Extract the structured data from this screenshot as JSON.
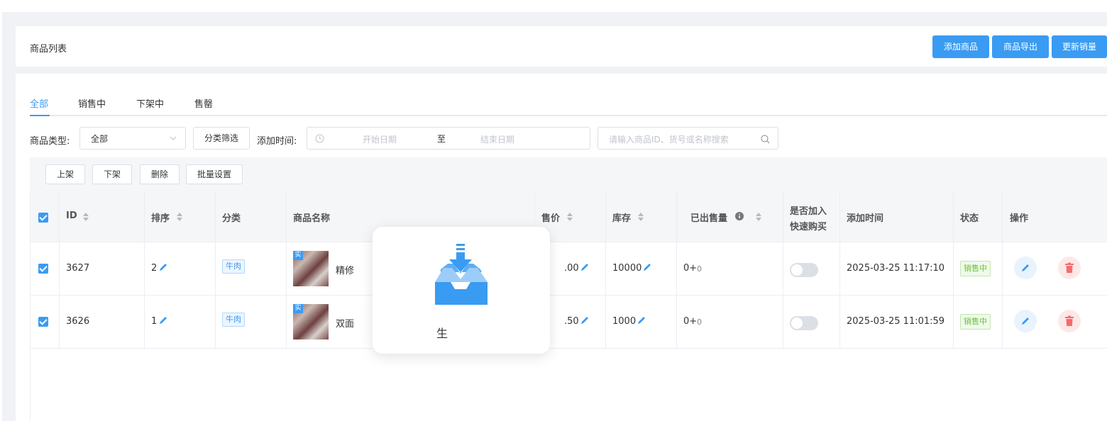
{
  "header": {
    "title": "商品列表",
    "buttons": [
      "添加商品",
      "商品导出",
      "更新销量"
    ]
  },
  "tabs": [
    "全部",
    "销售中",
    "下架中",
    "售罄"
  ],
  "filters": {
    "type_label": "商品类型:",
    "type_value": "全部",
    "category_button": "分类筛选",
    "time_label": "添加时间:",
    "start_placeholder": "开始日期",
    "range_separator": "至",
    "end_placeholder": "结束日期",
    "search_placeholder": "请输入商品ID、货号或名称搜索"
  },
  "toolbar": [
    "上架",
    "下架",
    "删除",
    "批量设置"
  ],
  "table": {
    "headers": {
      "id": "ID",
      "sort": "排序",
      "category": "分类",
      "name": "商品名称",
      "price": "售价",
      "stock": "库存",
      "sold": "已出售量",
      "quick_line1": "是否加入",
      "quick_line2": "快速购买",
      "time": "添加时间",
      "status": "状态",
      "actions": "操作"
    },
    "rows": [
      {
        "id": "3627",
        "sort": "2",
        "category": "牛肉",
        "thumb_badge": "实",
        "name": "精修",
        "price": ".00",
        "stock": "10000",
        "sold": "0+",
        "sold_extra": "0",
        "time": "2025-03-25 11:17:10",
        "status": "销售中"
      },
      {
        "id": "3626",
        "sort": "1",
        "category": "牛肉",
        "thumb_badge": "实",
        "name": "双面",
        "price": ".50",
        "stock": "1000",
        "sold": "0+",
        "sold_extra": "0",
        "time": "2025-03-25 11:01:59",
        "status": "销售中"
      }
    ]
  },
  "overlay": {
    "icon": "download-tray-icon",
    "text": "生"
  },
  "colors": {
    "primary": "#3a9bf2",
    "danger": "#f56c6c",
    "success": "#67c23a"
  }
}
